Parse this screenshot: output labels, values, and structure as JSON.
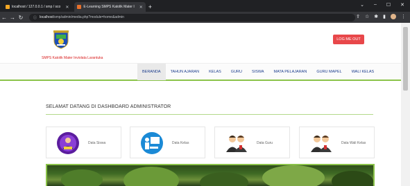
{
  "browser": {
    "tabs": [
      {
        "title": "localhost / 127.0.0.1 / smp / sco",
        "active": false,
        "favicon_color": "#f4a825"
      },
      {
        "title": "E-Learning SMPS Katolik Mater I",
        "active": true,
        "favicon_color": "#e8702a"
      }
    ],
    "new_tab": "+",
    "url_host": "localhost",
    "url_path": "/smp/admin/media.php?module=home&admin",
    "window_controls": [
      "⌄",
      "–",
      "☐",
      "✕"
    ]
  },
  "header": {
    "school_name": "SMPS Katolik Mater Inviolata Larantuka",
    "logout_label": "LOG ME OUT"
  },
  "menu": [
    {
      "label": "BERANDA",
      "active": true
    },
    {
      "label": "TAHUN AJARAN",
      "active": false
    },
    {
      "label": "KELAS",
      "active": false
    },
    {
      "label": "GURU",
      "active": false
    },
    {
      "label": "SISWA",
      "active": false
    },
    {
      "label": "MATA PELAJARAN",
      "active": false
    },
    {
      "label": "GURU MAPEL",
      "active": false
    },
    {
      "label": "WALI KELAS",
      "active": false
    }
  ],
  "welcome": "SELAMAT DATANG DI DASHBOARD ADMINISTRATOR",
  "cards": [
    {
      "label": "Data Siswa",
      "icon": "student-icon"
    },
    {
      "label": "Data Kelas",
      "icon": "classroom-icon"
    },
    {
      "label": "Data Guru",
      "icon": "teachers-icon"
    },
    {
      "label": "Data Wali Kelas",
      "icon": "homeroom-teachers-icon"
    }
  ],
  "colors": {
    "accent_green": "#8bc34a",
    "logout_red": "#e8474a",
    "menu_blue": "#1a3b8c",
    "school_red": "#d81b1b"
  }
}
